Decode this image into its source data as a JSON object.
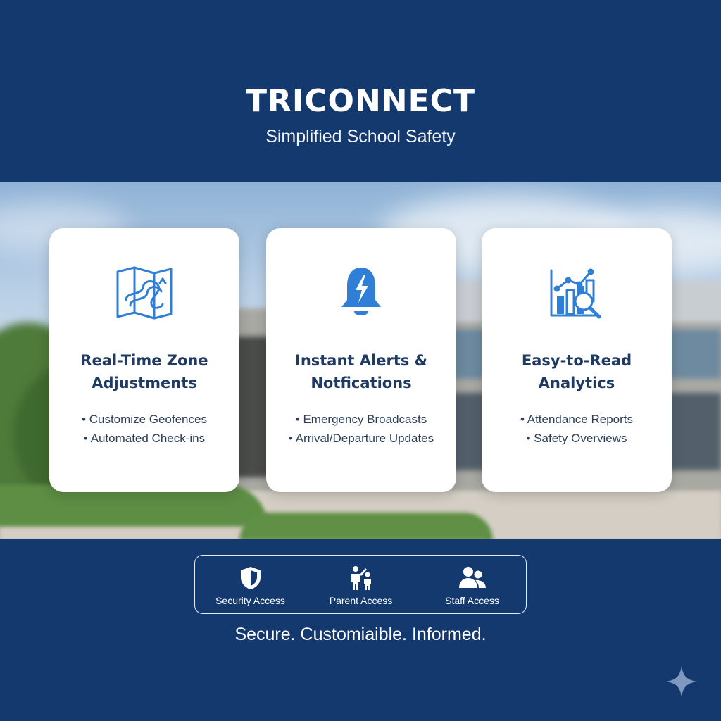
{
  "header": {
    "brand": "TRICONNECT",
    "tagline": "Simplified School Safety"
  },
  "cards": [
    {
      "icon": "map-route-icon",
      "title_line1": "Real-Time Zone",
      "title_line2": "Adjustments",
      "bullets": [
        "Customize Geofences",
        "Automated Check-ins"
      ]
    },
    {
      "icon": "alert-bell-icon",
      "title_line1": "Instant Alerts &",
      "title_line2": "Notfications",
      "bullets": [
        "Emergency Broadcasts",
        "Arrival/Departure Updates"
      ]
    },
    {
      "icon": "analytics-chart-icon",
      "title_line1": "Easy-to-Read",
      "title_line2": "Analytics",
      "bullets": [
        "Attendance Reports",
        "Safety Overviews"
      ]
    }
  ],
  "access": [
    {
      "icon": "shield-icon",
      "label": "Security Access"
    },
    {
      "icon": "parent-child-icon",
      "label": "Parent Access"
    },
    {
      "icon": "staff-group-icon",
      "label": "Staff Access"
    }
  ],
  "motto": "Secure. Customiaible. Informed.",
  "colors": {
    "navy": "#14396f",
    "accent_blue": "#2f7fd6",
    "card_title": "#1f3a63"
  }
}
